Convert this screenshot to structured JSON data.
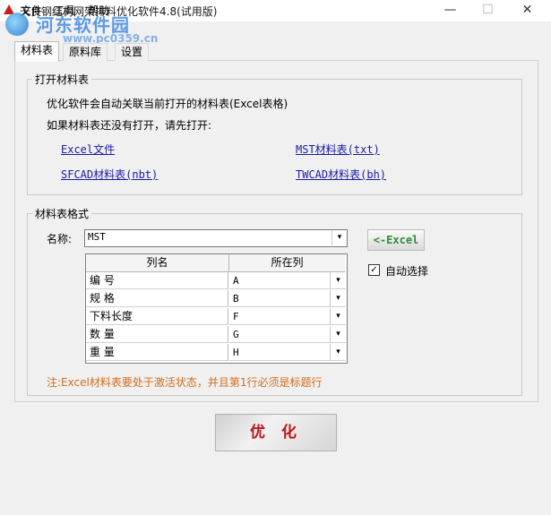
{
  "window": {
    "title": "天良钢结构网架排料优化软件4.8(试用版)",
    "minimize": "—",
    "maximize": "☐",
    "close": "✕"
  },
  "watermark": {
    "title": "河东软件园",
    "url": "www.pc0359.cn"
  },
  "menu": {
    "file": "文件",
    "tools": "工具",
    "help": "帮助"
  },
  "tabs": [
    "材料表",
    "原料库",
    "设置"
  ],
  "open_group": {
    "title": "打开材料表",
    "auto_link_text": "优化软件会自动关联当前打开的材料表(Excel表格)",
    "not_open_text": "如果材料表还没有打开，请先打开:",
    "links": {
      "excel": "Excel文件",
      "mst": "MST材料表(txt)",
      "sfcad": "SFCAD材料表(nbt)",
      "twcad": "TWCAD材料表(bh)"
    }
  },
  "format_group": {
    "title": "材料表格式",
    "name_label": "名称:",
    "name_value": "MST",
    "excel_button": "<-Excel",
    "auto_select_label": "自动选择",
    "auto_select_checked": "✓",
    "columns": {
      "name": "列名",
      "column": "所在列"
    },
    "rows": [
      {
        "name": "编  号",
        "col": "A"
      },
      {
        "name": "规  格",
        "col": "B"
      },
      {
        "name": "下料长度",
        "col": "F"
      },
      {
        "name": "数  量",
        "col": "G"
      },
      {
        "name": "重  量",
        "col": "H"
      }
    ],
    "note": "注:Excel材料表要处于激活状态，并且第1行必须是标题行"
  },
  "optimize_button": "优 化",
  "icons": {
    "dropdown": "▾"
  }
}
